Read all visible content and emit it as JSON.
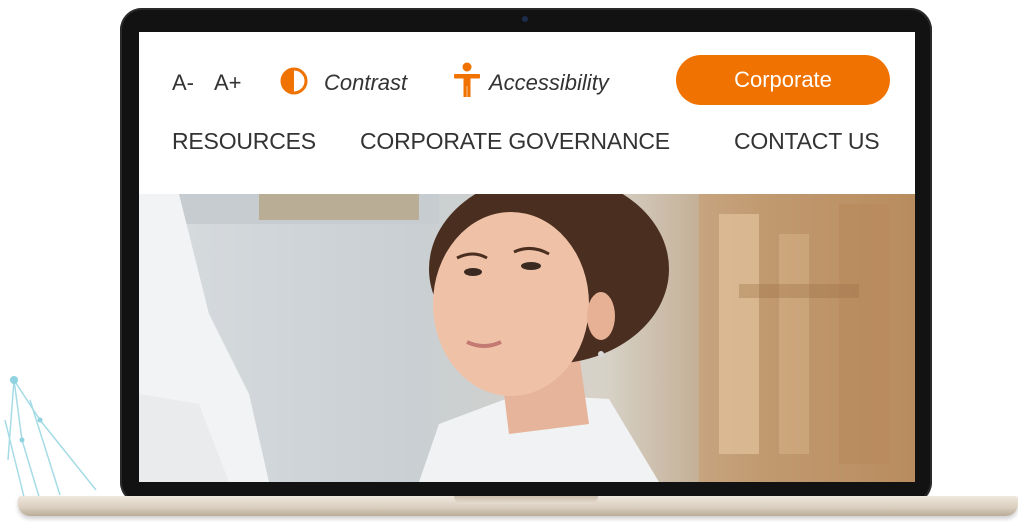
{
  "header": {
    "font_decrease": "A-",
    "font_increase": "A+",
    "contrast_label": "Contrast",
    "accessibility_label": "Accessibility",
    "corporate_button": "Corporate"
  },
  "nav": {
    "items": [
      {
        "label": "RESOURCES"
      },
      {
        "label": "CORPORATE GOVERNANCE"
      },
      {
        "label": "CONTACT US"
      }
    ]
  },
  "colors": {
    "accent": "#f07200",
    "text": "#333333",
    "device_bezel": "#121212"
  },
  "icons": {
    "contrast": "contrast-icon",
    "accessibility": "accessibility-icon"
  }
}
